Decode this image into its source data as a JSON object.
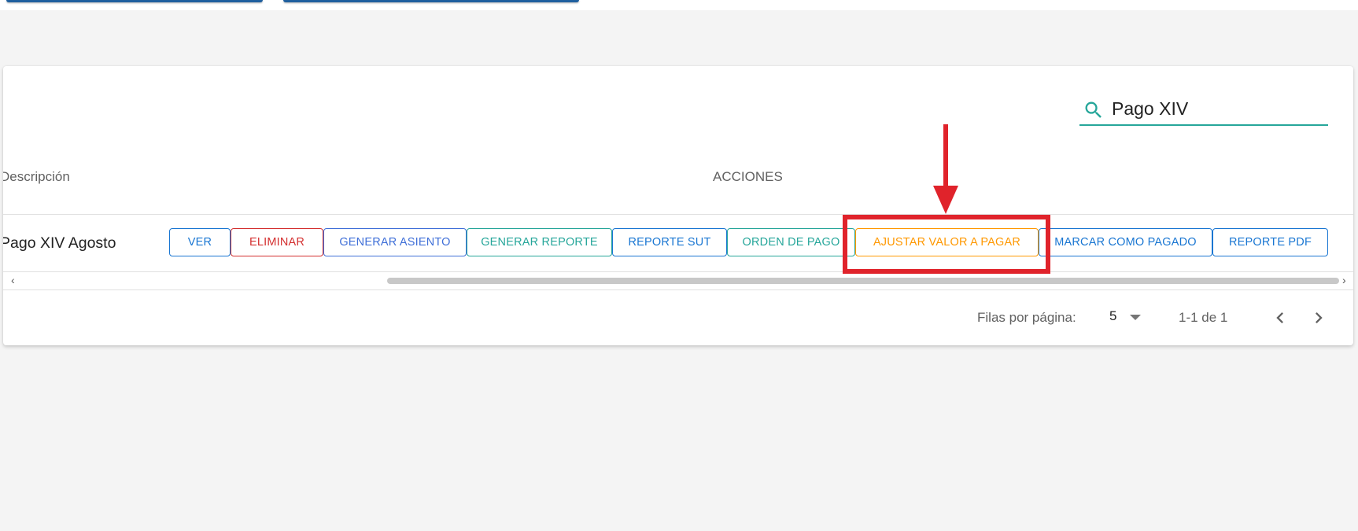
{
  "search": {
    "value": "Pago XIV",
    "icon": "search-icon"
  },
  "table": {
    "columns": [
      "Descripción",
      "ACCIONES"
    ],
    "rows": [
      {
        "descripcion": "Pago XIV Agosto"
      }
    ],
    "actions": [
      {
        "label": "VER",
        "color": "#1976d2"
      },
      {
        "label": "ELIMINAR",
        "color": "#d32f2f"
      },
      {
        "label": "GENERAR ASIENTO",
        "color": "#3f6fd8"
      },
      {
        "label": "GENERAR REPORTE",
        "color": "#26a69a"
      },
      {
        "label": "REPORTE SUT",
        "color": "#1976d2"
      },
      {
        "label": "ORDEN DE PAGO",
        "color": "#26a69a"
      },
      {
        "label": "AJUSTAR VALOR A PAGAR",
        "color": "#ff9800"
      },
      {
        "label": "MARCAR COMO PAGADO",
        "color": "#1976d2"
      },
      {
        "label": "REPORTE PDF",
        "color": "#1976d2"
      }
    ]
  },
  "footer": {
    "rows_per_page_label": "Filas por página:",
    "rows_per_page_value": "5",
    "range": "1-1 de 1"
  },
  "colors": {
    "accent": "#26a69a",
    "annotation": "#e0232b"
  }
}
